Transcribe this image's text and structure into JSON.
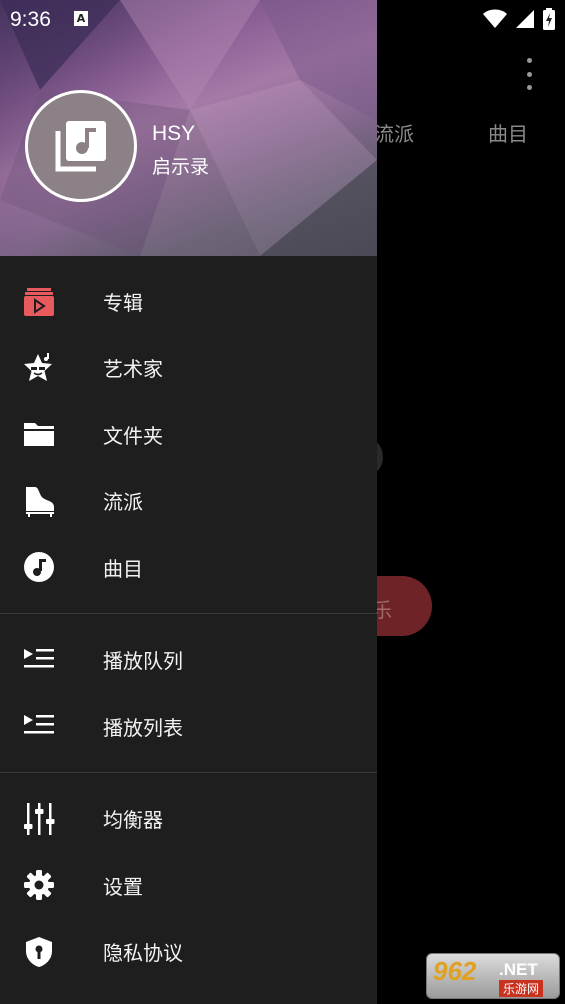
{
  "status_bar": {
    "time": "9:36",
    "notification_glyph": "A"
  },
  "background_app": {
    "tabs": [
      "流派",
      "曲目"
    ],
    "button_label": "乐"
  },
  "drawer": {
    "header": {
      "title": "HSY",
      "subtitle": "启示录",
      "avatar_icon": "music-library-icon"
    },
    "sections": [
      [
        {
          "icon": "album-icon",
          "label": "专辑"
        },
        {
          "icon": "artist-star-icon",
          "label": "艺术家"
        },
        {
          "icon": "folder-icon",
          "label": "文件夹"
        },
        {
          "icon": "piano-icon",
          "label": "流派"
        },
        {
          "icon": "music-note-icon",
          "label": "曲目"
        }
      ],
      [
        {
          "icon": "play-queue-icon",
          "label": "播放队列"
        },
        {
          "icon": "playlist-icon",
          "label": "播放列表"
        }
      ],
      [
        {
          "icon": "equalizer-icon",
          "label": "均衡器"
        },
        {
          "icon": "gear-icon",
          "label": "设置"
        },
        {
          "icon": "privacy-shield-icon",
          "label": "隐私协议"
        }
      ]
    ]
  },
  "colors": {
    "accent": "#e85a5e",
    "drawer_bg": "#1e1e1e",
    "divider": "#3a3a3a"
  },
  "watermark": {
    "logo": "962",
    "suffix": ".NET",
    "caption": "乐游网"
  }
}
